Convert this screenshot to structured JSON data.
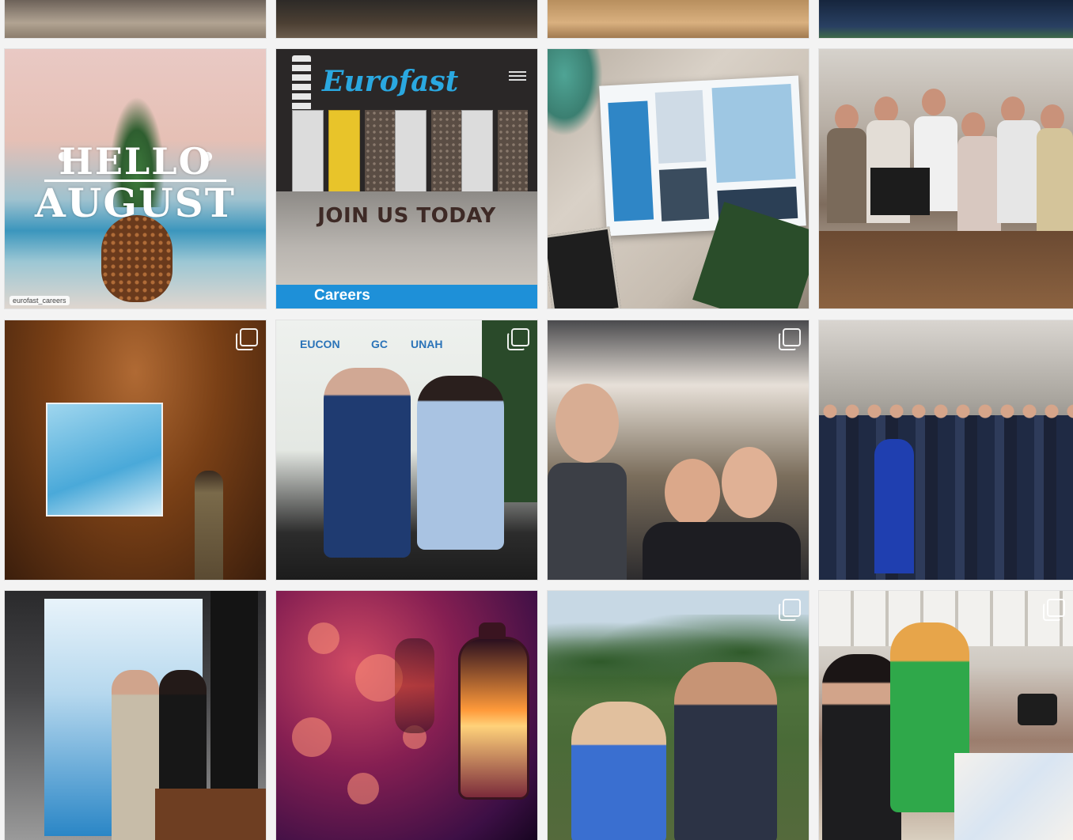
{
  "grid": {
    "tiles": [
      {
        "id": "t01",
        "label": ""
      },
      {
        "id": "t02",
        "label": ""
      },
      {
        "id": "t03",
        "label": ""
      },
      {
        "id": "t04",
        "label": ""
      }
    ]
  },
  "post_hello_august": {
    "line1": "HELLO",
    "line2": "AUGUST",
    "handle": "eurofast_careers"
  },
  "post_careers": {
    "brand": "Eurofast",
    "headline": "JOIN US TODAY",
    "footer": "Careers"
  },
  "post_panel": {
    "logo1": "EUCON",
    "logo2": "GC",
    "logo3": "UNAH"
  },
  "icons": {
    "multi": "multiple-photos-icon"
  }
}
